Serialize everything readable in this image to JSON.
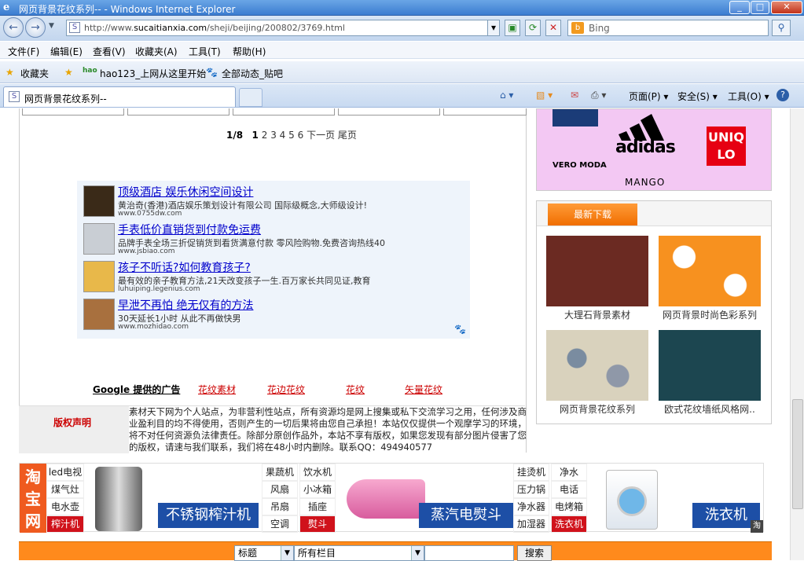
{
  "window": {
    "title": "网页背景花纹系列-- - Windows Internet Explorer"
  },
  "address": {
    "url_prefix": "http://www.",
    "url_domain": "sucaitianxia.com",
    "url_path": "/sheji/beijing/200802/3769.html",
    "search_placeholder": "Bing"
  },
  "menu": [
    "文件(F)",
    "编辑(E)",
    "查看(V)",
    "收藏夹(A)",
    "工具(T)",
    "帮助(H)"
  ],
  "favbar": {
    "favorites": "收藏夹",
    "item1": "hao123_上网从这里开始",
    "item2": "全部动态_贴吧"
  },
  "tab": {
    "title": "网页背景花纹系列--"
  },
  "commandbar": {
    "page": "页面(P)",
    "safety": "安全(S)",
    "tools": "工具(O)"
  },
  "pager": {
    "current": "1/8",
    "pages": [
      "1",
      "2",
      "3",
      "4",
      "5",
      "6"
    ],
    "next": "下一页",
    "last": "尾页"
  },
  "ads": [
    {
      "title": "顶级酒店 娱乐休闲空间设计",
      "desc": "黄治奇(香港)酒店娱乐策划设计有限公司 国际级概念,大师级设计!",
      "url": "www.0755dw.com"
    },
    {
      "title": "手表低价直销货到付款免运费",
      "desc": "品牌手表全场三折促销货到看货满意付款 零风险购物.免费咨询热线40",
      "url": "www.jsbiao.com"
    },
    {
      "title": "孩子不听话?如何教育孩子?",
      "desc": "最有效的亲子教育方法,21天改变孩子一生.百万家长共同见证,教育",
      "url": "luhuiping.legenius.com"
    },
    {
      "title": "早泄不再怕 绝无仅有的方法",
      "desc": "30天延长1小时 从此不再做快男",
      "url": "www.mozhidao.com"
    }
  ],
  "google_links": {
    "label": "Google 提供的广告",
    "links": [
      "花纹素材",
      "花边花纹",
      "花纹",
      "矢量花纹"
    ]
  },
  "copyright": {
    "label": "版权声明",
    "text": "素材天下网为个人站点，为非营利性站点，所有资源均是网上搜集或私下交流学习之用，任何涉及商业盈利目的均不得使用，否则产生的一切后果将由您自己承担！本站仅仅提供一个观摩学习的环境，将不对任何资源负法律责任。除部分原创作品外，本站不享有版权，如果您发现有部分图片侵害了您的版权，请速与我们联系，我们将在48小时内删除。联系QQ：494940577"
  },
  "brands": {
    "b1": "adidas",
    "b2": "UNIQLO",
    "b3": "VERO MODA",
    "b4": "MANGO"
  },
  "downloads": {
    "heading": "最新下载",
    "items": [
      {
        "caption": "大理石背景素材",
        "color": "#6b2a22"
      },
      {
        "caption": "网页背景时尚色彩系列",
        "color": "#f7911f"
      },
      {
        "caption": "网页背景花纹系列",
        "color": "#d9d2bd"
      },
      {
        "caption": "欧式花纹墙纸风格网..",
        "color": "#1c4650"
      }
    ]
  },
  "banner": {
    "logo": "淘宝网",
    "col1": [
      "led电视",
      "煤气灶",
      "电水壶",
      "榨汁机"
    ],
    "promo1": "不锈钢榨汁机",
    "col2a": [
      "果蔬机",
      "风扇",
      "吊扇",
      "空调"
    ],
    "col2b": [
      "饮水机",
      "小冰箱",
      "插座",
      "熨斗"
    ],
    "promo2": "蒸汽电熨斗",
    "col3a": [
      "挂烫机",
      "压力锅",
      "净水器",
      "加湿器"
    ],
    "col3b": [
      "净水",
      "电话",
      "电烤箱",
      "洗衣机"
    ],
    "promo3": "洗衣机",
    "corner": "淘"
  },
  "search": {
    "field": "标题",
    "column": "所有栏目",
    "button": "搜索"
  }
}
